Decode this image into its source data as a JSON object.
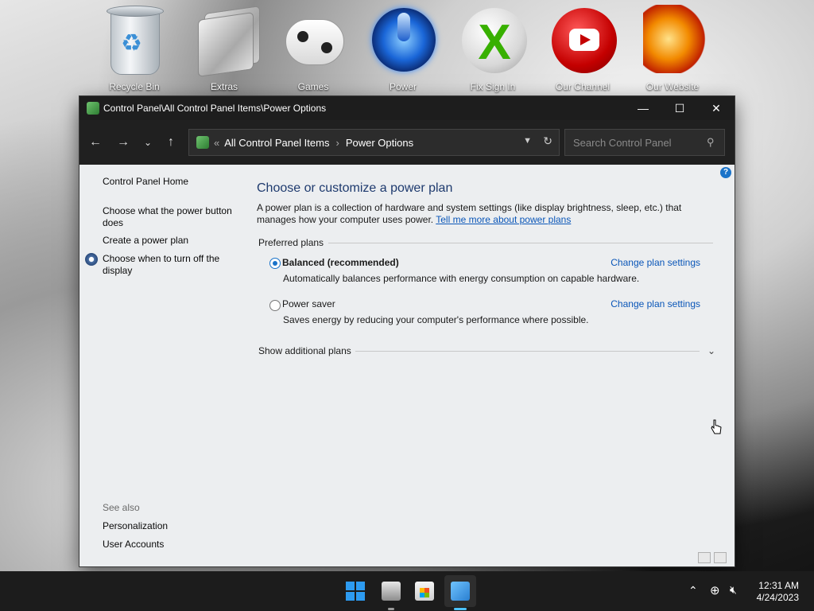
{
  "desktop": {
    "icons": [
      {
        "label": "Recycle Bin",
        "icon": "recycle-bin-icon"
      },
      {
        "label": "Extras",
        "icon": "folder-icon"
      },
      {
        "label": "Games",
        "icon": "gamepad-icon"
      },
      {
        "label": "Power",
        "icon": "power-icon"
      },
      {
        "label": "Fix Sign In",
        "icon": "xbox-icon"
      },
      {
        "label": "Our Channel",
        "icon": "youtube-icon"
      },
      {
        "label": "Our Website",
        "icon": "phoenix-icon"
      }
    ]
  },
  "window": {
    "title": "Control Panel\\All Control Panel Items\\Power Options",
    "controls": {
      "minimize": "—",
      "maximize": "☐",
      "close": "✕"
    }
  },
  "nav": {
    "back": "←",
    "forward": "→",
    "recent": "⌄",
    "up": "↑",
    "address": {
      "overflow": "«",
      "crumbs": [
        "All Control Panel Items",
        "Power Options"
      ],
      "separator": "›"
    },
    "search_placeholder": "Search Control Panel"
  },
  "left_pane": {
    "home": "Control Panel Home",
    "links": [
      "Choose what the power button does",
      "Create a power plan",
      "Choose when to turn off the display"
    ],
    "see_also_heading": "See also",
    "see_also": [
      "Personalization",
      "User Accounts"
    ]
  },
  "main": {
    "title": "Choose or customize a power plan",
    "description": "A power plan is a collection of hardware and system settings (like display brightness, sleep, etc.) that manages how your computer uses power.",
    "learn_more": "Tell me more about power plans",
    "preferred_heading": "Preferred plans",
    "plans": [
      {
        "name": "Balanced (recommended)",
        "selected": true,
        "description": "Automatically balances performance with energy consumption on capable hardware.",
        "change": "Change plan settings"
      },
      {
        "name": "Power saver",
        "selected": false,
        "description": "Saves energy by reducing your computer's performance where possible.",
        "change": "Change plan settings"
      }
    ],
    "additional": "Show additional plans"
  },
  "taskbar": {
    "apps": [
      "windows-start-icon",
      "file-explorer-icon",
      "microsoft-store-icon",
      "control-panel-icon"
    ],
    "time": "12:31 AM",
    "date": "4/24/2023"
  },
  "colors": {
    "accent": "#1a73c9",
    "link": "#0a56b8",
    "title_blue": "#1e3a6e",
    "titlebar": "#1d1d1d"
  }
}
